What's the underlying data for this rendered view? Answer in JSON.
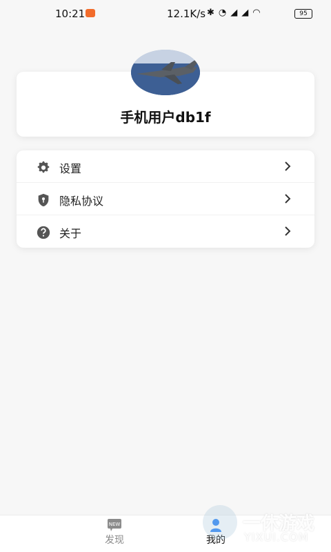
{
  "status_bar": {
    "time": "10:21",
    "speed": "12.1K/s",
    "battery": "95"
  },
  "profile": {
    "username": "手机用户db1f",
    "avatar_icon": "jet-avatar"
  },
  "menu": {
    "items": [
      {
        "label": "设置",
        "icon": "gear-icon"
      },
      {
        "label": "隐私协议",
        "icon": "shield-icon"
      },
      {
        "label": "关于",
        "icon": "question-icon"
      }
    ]
  },
  "bottom_nav": {
    "discover_label": "发现",
    "discover_badge": "NEW",
    "mine_label": "我的"
  },
  "watermark": {
    "title": "一休游戏",
    "subtitle": "YIXUI.COM"
  },
  "colors": {
    "accent": "#2f86f6",
    "background": "#f7f7f7",
    "status_orange": "#f26c2b"
  }
}
